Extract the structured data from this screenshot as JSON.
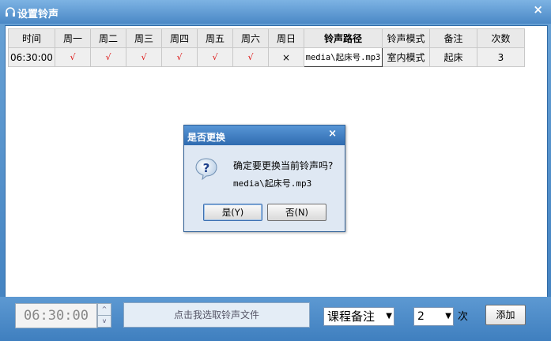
{
  "window": {
    "title": "设置铃声",
    "close_glyph": "×"
  },
  "table": {
    "headers": [
      "时间",
      "周一",
      "周二",
      "周三",
      "周四",
      "周五",
      "周六",
      "周日",
      "铃声路径",
      "铃声模式",
      "备注",
      "次数"
    ],
    "rows": [
      [
        "06:30:00",
        "√",
        "√",
        "√",
        "√",
        "√",
        "√",
        "×",
        "media\\起床号.mp3",
        "室内模式",
        "起床",
        "3"
      ]
    ]
  },
  "dialog": {
    "title": "是否更换",
    "close_glyph": "×",
    "message": "确定要更换当前铃声吗?",
    "path": "media\\起床号.mp3",
    "yes_label": "是(Y)",
    "no_label": "否(N)"
  },
  "controls": {
    "time_value": "06:30:00",
    "spin_up": "^",
    "spin_down": "v",
    "file_button_label": "点击我选取铃声文件",
    "remark_select": "课程备注",
    "count_select": "2",
    "count_unit": "次",
    "add_button": "添加"
  },
  "colors": {
    "check": "#dd1111",
    "title_bar": "#4a88c6"
  },
  "icons": [
    "headphones-icon",
    "question-icon",
    "close-icon",
    "chevron-down-icon"
  ]
}
